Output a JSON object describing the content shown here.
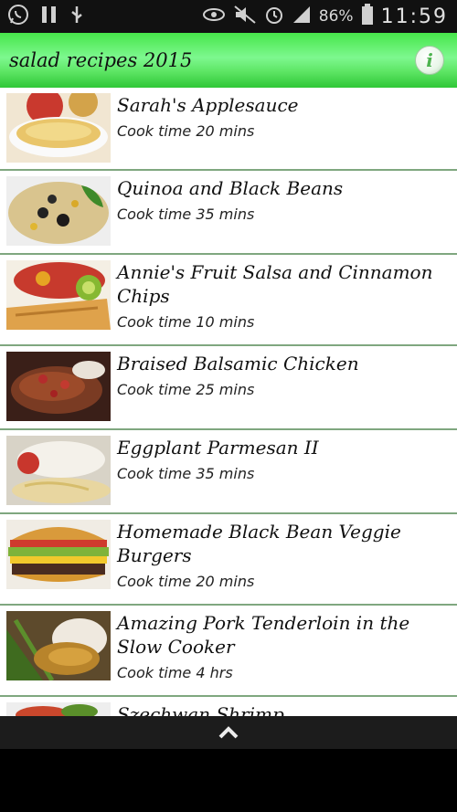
{
  "statusbar": {
    "battery_percent": "86%",
    "time": "11:59",
    "icons": [
      "whatsapp-icon",
      "pause-icon",
      "usb-icon",
      "eye-icon",
      "mute-icon",
      "alarm-icon",
      "signal-icon",
      "battery-icon"
    ]
  },
  "actionbar": {
    "title": "salad recipes 2015",
    "info_label": "i"
  },
  "colors": {
    "actionbar_green": "#5ee665",
    "divider": "#7fa77f"
  },
  "recipes": [
    {
      "name": "Sarah's Applesauce",
      "time": "Cook time 20 mins"
    },
    {
      "name": "Quinoa and Black Beans",
      "time": "Cook time 35 mins"
    },
    {
      "name": "Annie's Fruit Salsa and Cinnamon Chips",
      "time": "Cook time 10 mins"
    },
    {
      "name": "Braised Balsamic Chicken",
      "time": "Cook time 25 mins"
    },
    {
      "name": "Eggplant Parmesan II",
      "time": "Cook time 35 mins"
    },
    {
      "name": "Homemade Black Bean Veggie Burgers",
      "time": "Cook time 20 mins"
    },
    {
      "name": "Amazing Pork Tenderloin in the Slow Cooker",
      "time": "Cook time 4 hrs"
    },
    {
      "name": "Szechwan Shrimp",
      "time": ""
    }
  ],
  "bottombar": {
    "icon": "chevron-up-icon"
  }
}
